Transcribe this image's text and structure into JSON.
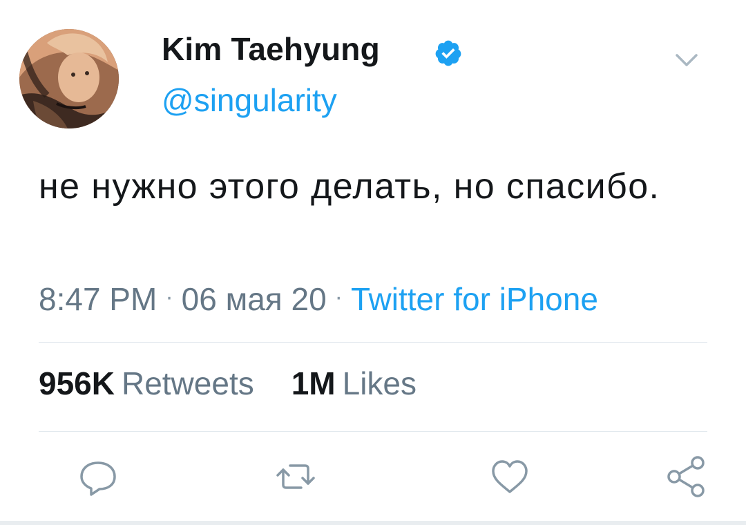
{
  "author": {
    "display_name": "Kim Taehyung",
    "handle": "@singularity",
    "verified": true
  },
  "tweet": {
    "text": "не нужно этого делать, но спасибо.",
    "time": "8:47 PM",
    "date": "06 мая 20",
    "source": "Twitter for iPhone"
  },
  "stats": {
    "retweets_count": "956K",
    "retweets_label": "Retweets",
    "likes_count": "1M",
    "likes_label": "Likes"
  },
  "icons": {
    "reply": "reply-icon",
    "retweet": "retweet-icon",
    "like": "heart-icon",
    "share": "share-icon",
    "menu": "chevron-down-icon",
    "verified": "verified-badge-icon"
  },
  "colors": {
    "accent": "#1da1f2",
    "text": "#14171a",
    "muted": "#657786",
    "icon": "#8899a6",
    "divider": "#e1e8ed"
  }
}
